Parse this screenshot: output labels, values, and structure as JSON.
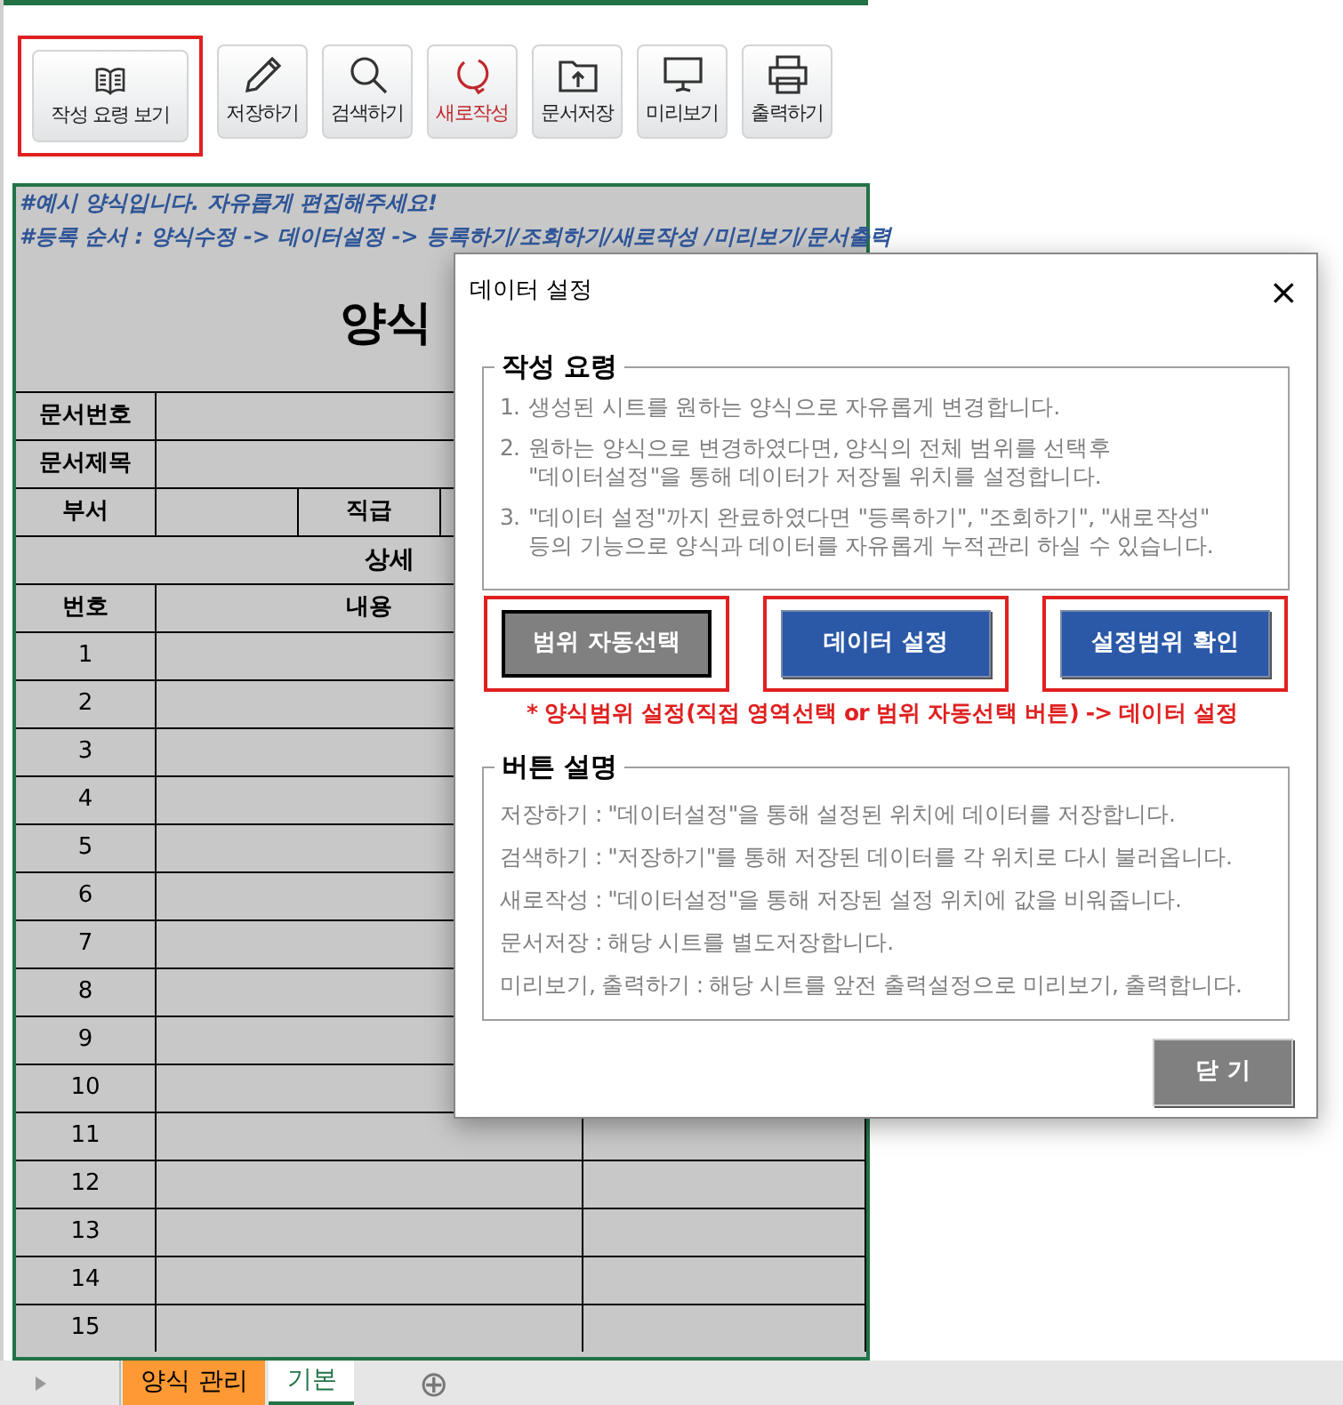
{
  "toolbar": [
    {
      "label": "작성 요령 보기",
      "kind": "guide",
      "highlighted": true
    },
    {
      "label": "저장하기",
      "kind": "save",
      "highlighted": false
    },
    {
      "label": "검색하기",
      "kind": "search",
      "highlighted": false
    },
    {
      "label": "새로작성",
      "kind": "new",
      "highlighted": false
    },
    {
      "label": "문서저장",
      "kind": "folder",
      "highlighted": false
    },
    {
      "label": "미리보기",
      "kind": "preview",
      "highlighted": false
    },
    {
      "label": "출력하기",
      "kind": "print",
      "highlighted": false
    }
  ],
  "sheet": {
    "notes": [
      "#예시 양식입니다. 자유롭게 편집해주세요!",
      "#등록 순서 : 양식수정 -> 데이터설정 -> 등록하기/조회하기/새로작성 /미리보기/문서출력"
    ],
    "title": "양식",
    "fields": [
      {
        "label": "문서번호"
      },
      {
        "label": "문서제목"
      }
    ],
    "dept_row": {
      "label": "부서",
      "label_2": "직급"
    },
    "section": "상세",
    "columns": [
      "번호",
      "내용"
    ],
    "rows": [
      "1",
      "2",
      "3",
      "4",
      "5",
      "6",
      "7",
      "8",
      "9",
      "10",
      "11",
      "12",
      "13",
      "14",
      "15"
    ]
  },
  "dialog": {
    "title": "데이터 설정",
    "close": "×",
    "guide": {
      "legend": "작성 요령",
      "items": [
        {
          "number": "1.",
          "lines": [
            "생성된 시트를 원하는 양식으로 자유롭게 변경합니다."
          ]
        },
        {
          "number": "2.",
          "lines": [
            "원하는 양식으로 변경하였다면, 양식의 전체 범위를 선택후",
            "\"데이터설정\"을 통해 데이터가 저장될 위치를 설정합니다."
          ]
        },
        {
          "number": "3.",
          "lines": [
            "\"데이터 설정\"까지 완료하였다면 \"등록하기\", \"조회하기\", \"새로작성\"",
            "등의 기능으로 양식과 데이터를 자유롭게 누적관리 하실 수 있습니다."
          ]
        }
      ]
    },
    "buttons": [
      {
        "label": "범위 자동선택",
        "kind": "secondary",
        "highlighted": true
      },
      {
        "label": "데이터 설정",
        "kind": "primary",
        "highlighted": true
      },
      {
        "label": "설정범위 확인",
        "kind": "primary",
        "highlighted": true
      }
    ],
    "note": "* 양식범위 설정(직접 영역선택 or 범위 자동선택 버튼) -> 데이터 설정",
    "help": {
      "legend": "버튼 설명",
      "lines": [
        "저장하기 : \"데이터설정\"을 통해 설정된 위치에 데이터를 저장합니다.",
        "검색하기 : \"저장하기\"를 통해 저장된 데이터를 각 위치로 다시 불러옵니다.",
        "새로작성 : \"데이터설정\"을 통해 저장된 설정 위치에 값을 비워줍니다.",
        "문서저장 : 해당 시트를 별도저장합니다.",
        "미리보기, 출력하기 : 해당 시트를 앞전 출력설정으로 미리보기, 출력합니다."
      ]
    },
    "close_button": "닫 기"
  },
  "sheet_tabs": [
    {
      "label": "양식 관리",
      "selected": false,
      "color": "#ff9933"
    },
    {
      "label": "기본",
      "selected": true,
      "color": "#ffffff"
    }
  ],
  "add_sheet": "⊕"
}
